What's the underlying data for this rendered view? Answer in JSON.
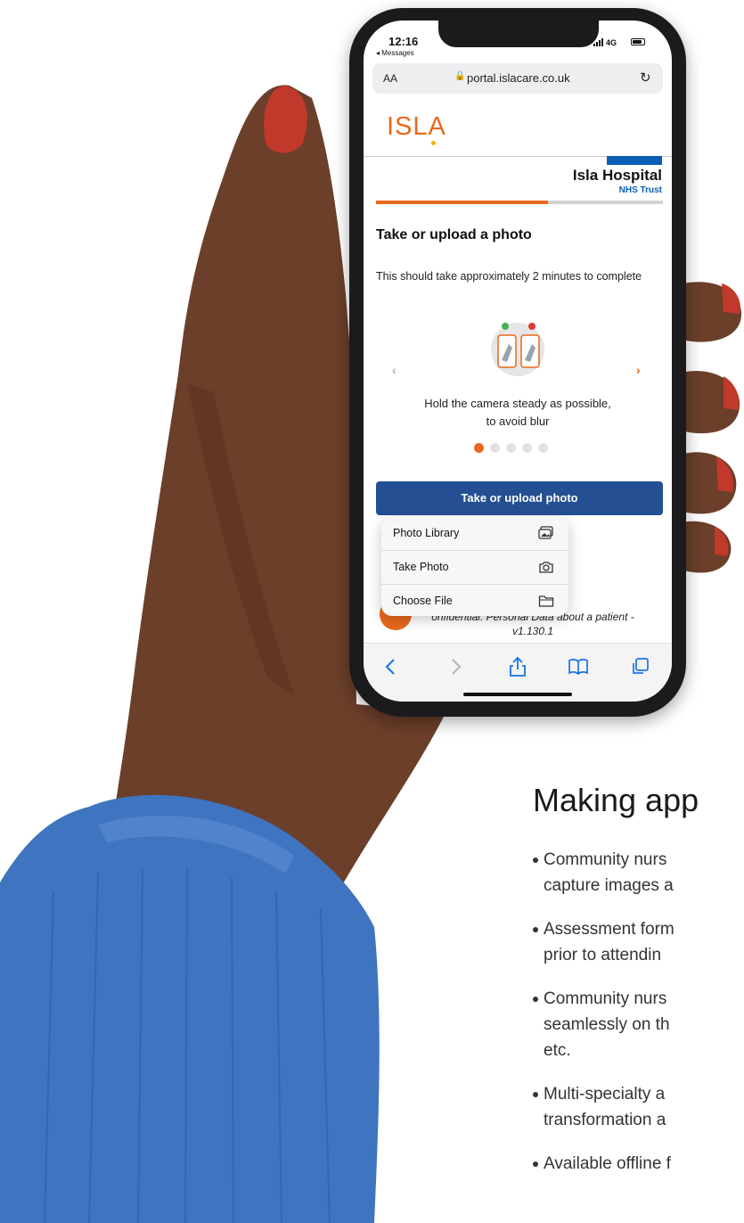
{
  "status_bar": {
    "time": "12:16",
    "back_label": "◂ Messages",
    "network": "4G"
  },
  "browser": {
    "text_size_label": "AA",
    "url": "portal.islacare.co.uk"
  },
  "header": {
    "logo_text": "ISLA",
    "hospital_name": "Isla Hospital",
    "trust_name": "NHS Trust"
  },
  "progress": {
    "fraction": 0.6
  },
  "page": {
    "title": "Take or upload a photo",
    "time_note": "This should take approximately 2 minutes to complete"
  },
  "carousel": {
    "caption": "Hold the camera steady as possible, to avoid blur",
    "slide_count": 5,
    "active_index": 0
  },
  "primary_button": {
    "label": "Take or upload photo"
  },
  "upload_menu": {
    "items": [
      {
        "label": "Photo Library",
        "icon": "photo-library-icon"
      },
      {
        "label": "Take Photo",
        "icon": "camera-icon"
      },
      {
        "label": "Choose File",
        "icon": "folder-icon"
      }
    ]
  },
  "footer": {
    "note": "onfidential: Personal Data about a patient -",
    "version": "v1.130.1"
  },
  "marketing": {
    "headline": "Making app",
    "bullets": [
      "Community nurs\ncapture images a",
      "Assessment form\nprior to attendin",
      "Community nurs\nseamlessly on th\netc.",
      "Multi-specialty a\ntransformation a",
      "Available offline f"
    ]
  },
  "colors": {
    "accent": "#e8681c",
    "primary": "#244f92",
    "nhs_blue": "#0a5eb5",
    "sweater": "#3f74c0"
  }
}
